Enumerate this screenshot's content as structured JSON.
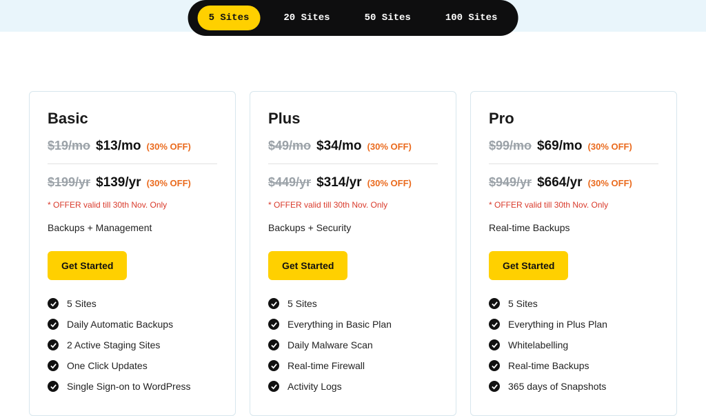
{
  "tabs": {
    "items": [
      "5 Sites",
      "20 Sites",
      "50 Sites",
      "100 Sites"
    ],
    "active_index": 0
  },
  "offer_text": "OFFER valid till 30th Nov. Only",
  "discount_label": "(30% OFF)",
  "cta_label": "Get Started",
  "plans": [
    {
      "name": "Basic",
      "old_mo": "$19/mo",
      "new_mo": "$13/mo",
      "old_yr": "$199/yr",
      "new_yr": "$139/yr",
      "tagline": "Backups + Management",
      "features": [
        "5 Sites",
        "Daily Automatic Backups",
        "2 Active Staging Sites",
        "One Click Updates",
        "Single Sign-on to WordPress"
      ]
    },
    {
      "name": "Plus",
      "old_mo": "$49/mo",
      "new_mo": "$34/mo",
      "old_yr": "$449/yr",
      "new_yr": "$314/yr",
      "tagline": "Backups + Security",
      "features": [
        "5 Sites",
        "Everything in Basic Plan",
        "Daily Malware Scan",
        "Real-time Firewall",
        "Activity Logs"
      ]
    },
    {
      "name": "Pro",
      "old_mo": "$99/mo",
      "new_mo": "$69/mo",
      "old_yr": "$949/yr",
      "new_yr": "$664/yr",
      "tagline": "Real-time Backups",
      "features": [
        "5 Sites",
        "Everything in Plus Plan",
        "Whitelabelling",
        "Real-time Backups",
        "365 days of Snapshots"
      ]
    }
  ]
}
